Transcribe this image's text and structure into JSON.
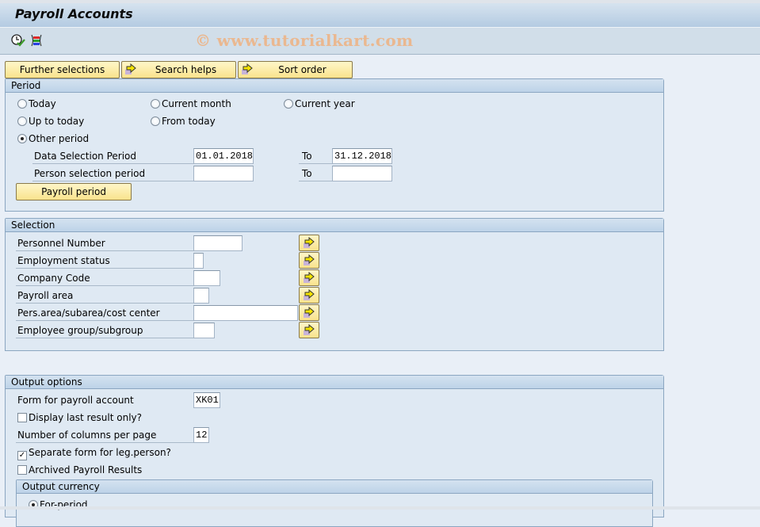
{
  "window": {
    "title": "Payroll Accounts"
  },
  "toolbar": {
    "icons": [
      "execute-clock-icon",
      "variant-icon"
    ],
    "watermark": "© www.tutorialkart.com"
  },
  "buttons": {
    "further_selections": "Further selections",
    "search_helps": "Search helps",
    "sort_order": "Sort order"
  },
  "period": {
    "title": "Period",
    "radios": [
      {
        "label": "Today",
        "selected": false
      },
      {
        "label": "Current month",
        "selected": false
      },
      {
        "label": "Current year",
        "selected": false
      },
      {
        "label": "Up to today",
        "selected": false
      },
      {
        "label": "From today",
        "selected": false
      },
      {
        "label": "Other period",
        "selected": true
      }
    ],
    "data_selection_label": "Data Selection Period",
    "data_selection_from": "01.01.2018",
    "data_selection_to_label": "To",
    "data_selection_to": "31.12.2018",
    "person_selection_label": "Person selection period",
    "person_selection_from": "",
    "person_selection_to_label": "To",
    "person_selection_to": "",
    "payroll_period_button": "Payroll period"
  },
  "selection": {
    "title": "Selection",
    "fields": [
      {
        "label": "Personnel Number",
        "value": ""
      },
      {
        "label": "Employment status",
        "value": ""
      },
      {
        "label": "Company Code",
        "value": ""
      },
      {
        "label": "Payroll area",
        "value": ""
      },
      {
        "label": "Pers.area/subarea/cost center",
        "value": ""
      },
      {
        "label": "Employee group/subgroup",
        "value": ""
      }
    ]
  },
  "output": {
    "title": "Output options",
    "form_label": "Form for payroll account",
    "form_value": "XK01",
    "display_last_label": "Display last result only?",
    "display_last_checked": false,
    "columns_label": "Number of columns per page",
    "columns_value": "12",
    "separate_form_label": "Separate form for leg.person?",
    "separate_form_checked": true,
    "archived_label": "Archived Payroll Results",
    "archived_checked": false,
    "currency": {
      "title": "Output currency",
      "for_period_label": "For-period",
      "for_period_selected": true
    }
  }
}
